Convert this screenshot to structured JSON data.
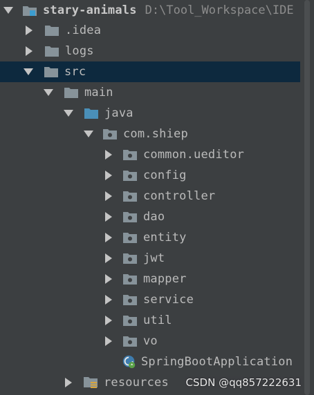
{
  "project": {
    "name": "stary-animals",
    "path": "D:\\Tool_Workspace\\IDE"
  },
  "tree": {
    "idea": ".idea",
    "logs": "logs",
    "src": "src",
    "main": "main",
    "java": "java",
    "package": "com.shiep",
    "subpackages": [
      "common.ueditor",
      "config",
      "controller",
      "dao",
      "entity",
      "jwt",
      "mapper",
      "service",
      "util",
      "vo"
    ],
    "app_class": "SpringBootApplication",
    "resources": "resources"
  },
  "watermark": "CSDN @qq857222631",
  "colors": {
    "background": "#3c3f41",
    "selection": "#0d293e",
    "text": "#bbbbbb",
    "path_text": "#8c8c8c",
    "folder": "#87939a",
    "source_folder": "#4a8fb8",
    "arrow": "#c4c4c4"
  },
  "icons": {
    "expanded_arrow": "chevron-down-icon",
    "collapsed_arrow": "chevron-right-icon",
    "folder": "folder-icon",
    "source_folder": "source-folder-icon",
    "package": "package-icon",
    "resources_folder": "resources-folder-icon",
    "spring_class": "spring-boot-class-icon"
  }
}
